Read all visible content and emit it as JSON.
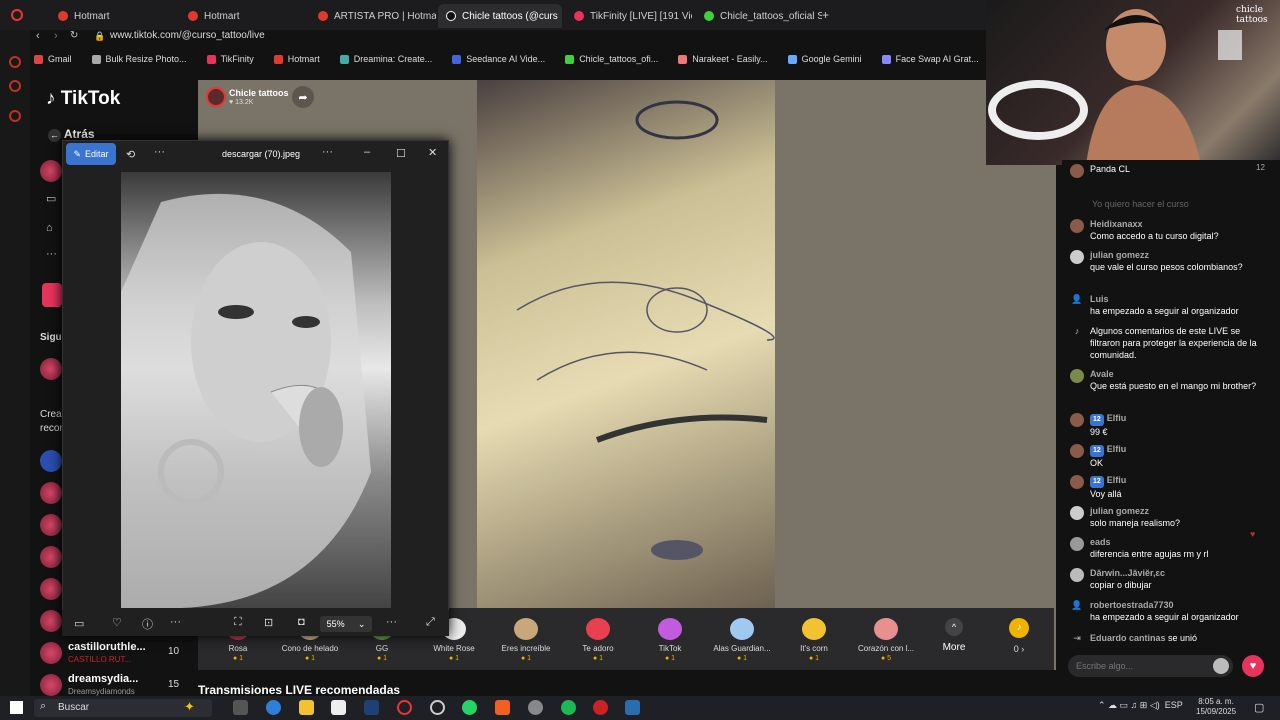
{
  "browser": {
    "tabs": [
      {
        "label": "Hotmart",
        "color": "#e03a2e"
      },
      {
        "label": "Hotmart",
        "color": "#e03a2e"
      },
      {
        "label": "ARTISTA PRO | Hotmart C",
        "color": "#e03a2e"
      },
      {
        "label": "Chicle tattoos (@curs",
        "color": "#111111"
      },
      {
        "label": "TikFinity [LIVE] [191 View",
        "color": "#e8335c"
      },
      {
        "label": "Chicle_tattoos_oficial Stre",
        "color": "#3fcf3f"
      }
    ],
    "url": "www.tiktok.com/@curso_tattoo/live",
    "bookmarks": [
      "Gmail",
      "Bulk Resize Photo...",
      "TikFinity",
      "Hotmart",
      "Dreamina: Create...",
      "Seedance AI Vide...",
      "Chicle_tattoos_ofi...",
      "Narakeet - Easily...",
      "Google Gemini",
      "Face Swap AI Grat..."
    ]
  },
  "sidebar": {
    "logo": "TikTok",
    "back": "Atrás",
    "section_following": "Sigui",
    "section_creators_1": "Crea",
    "section_creators_2": "recor",
    "follow_items": [
      {
        "name": "castilloruthle...",
        "sub": "CASTILLO RUT...",
        "count": "10"
      },
      {
        "name": "dreamsydia...",
        "sub": "Dreamsydiamonds",
        "count": "15"
      }
    ]
  },
  "live": {
    "streamer": "Chicle tattoos",
    "likes": "♥ 13.2K",
    "recommended": "Transmisiones LIVE recomendadas",
    "gifts": [
      {
        "name": "Rosa",
        "cost": "1",
        "color": "#d23b5a"
      },
      {
        "name": "Cono de helado",
        "cost": "1",
        "color": "#e7c59a"
      },
      {
        "name": "GG",
        "cost": "1",
        "color": "#6ab04c"
      },
      {
        "name": "White Rose",
        "cost": "1",
        "color": "#eeeeee"
      },
      {
        "name": "Eres increíble",
        "cost": "1",
        "color": "#c8a87a"
      },
      {
        "name": "Te adoro",
        "cost": "1",
        "color": "#e84050"
      },
      {
        "name": "TikTok",
        "cost": "1",
        "color": "#c35be0"
      },
      {
        "name": "Alas Guardian...",
        "cost": "1",
        "color": "#9fc9f0"
      },
      {
        "name": "It's corn",
        "cost": "1",
        "color": "#f2c230"
      },
      {
        "name": "Corazón con l...",
        "cost": "5",
        "color": "#e89090"
      }
    ],
    "more": "More",
    "coins": "0 ›"
  },
  "viewer": {
    "edit": "Editar",
    "title": "descargar (70).jpeg",
    "zoom": "55%"
  },
  "webcam": {
    "tag": "chicle tattoos"
  },
  "chat": {
    "top_user": "Panda CL",
    "top_count": "12",
    "faded": "Yo quiero hacer el curso",
    "messages": [
      {
        "user": "Heidixanaxx",
        "text": "Como accedo a tu curso digital?"
      },
      {
        "user": "julian gomezz",
        "text": "que vale el curso pesos colombianos?"
      },
      {
        "user": "Luis",
        "text": "ha empezado a seguir al organizador"
      },
      {
        "user": "",
        "text": "Algunos comentarios de este LIVE se filtraron para proteger la experiencia de la comunidad."
      },
      {
        "user": "Avale",
        "text": "Que está puesto en el mango mi brother?"
      },
      {
        "user": "Elfiu",
        "badge": "12",
        "text": "99 €"
      },
      {
        "user": "Elfiu",
        "badge": "12",
        "text": "OK"
      },
      {
        "user": "Elfiu",
        "badge": "12",
        "text": "Voy allá"
      },
      {
        "user": "julian gomezz",
        "text": "solo maneja realismo?"
      },
      {
        "user": "eads",
        "text": "diferencia entre agujas rm y rl"
      },
      {
        "user": "Dărwin...Jăviĕr,ɛc",
        "text": "copiar o dibujar"
      },
      {
        "user": "robertoestrada7730",
        "text": "ha empezado a seguir al organizador"
      },
      {
        "user": "Eduardo cantinas",
        "text": "se unió"
      }
    ],
    "input_placeholder": "Escribe algo..."
  },
  "taskbar": {
    "search": "Buscar",
    "lang": "ESP",
    "time": "8:05 a. m.",
    "date": "15/09/2025"
  }
}
